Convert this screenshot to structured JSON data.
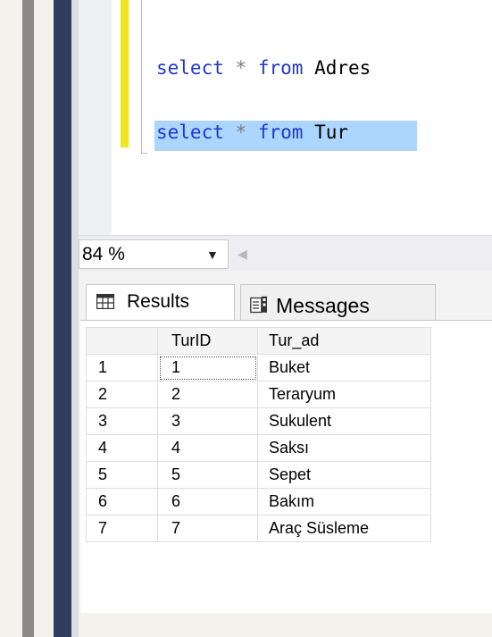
{
  "editor": {
    "lines": [
      {
        "kw1": "select",
        "op": "*",
        "kw2": "from",
        "ident": "Adres"
      },
      {
        "kw1": "select",
        "op": "*",
        "kw2": "from",
        "ident": "Tur"
      }
    ]
  },
  "zoom": {
    "value": "84 %"
  },
  "tabs": {
    "results": "Results",
    "messages": "Messages"
  },
  "results": {
    "columns": [
      "",
      "TurID",
      "Tur_ad"
    ],
    "rows": [
      [
        "1",
        "1",
        "Buket"
      ],
      [
        "2",
        "2",
        "Teraryum"
      ],
      [
        "3",
        "3",
        "Sukulent"
      ],
      [
        "4",
        "4",
        "Saksı"
      ],
      [
        "5",
        "5",
        "Sepet"
      ],
      [
        "6",
        "6",
        "Bakım"
      ],
      [
        "7",
        "7",
        "Araç Süsleme"
      ]
    ]
  }
}
